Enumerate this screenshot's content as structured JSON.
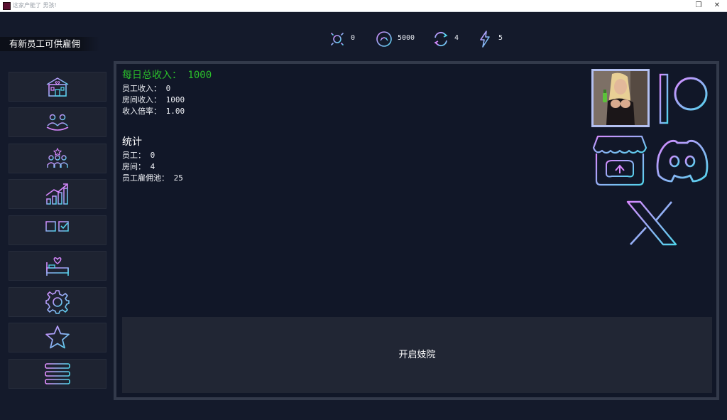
{
  "window": {
    "title": "这家产能了 男孩!",
    "restore_glyph": "❒",
    "close_glyph": "✕"
  },
  "notice": "有新员工可供雇佣",
  "stats": [
    {
      "icon": "sun-icon",
      "value": "0"
    },
    {
      "icon": "coin-icon",
      "value": "5000"
    },
    {
      "icon": "refresh-icon",
      "value": "4"
    },
    {
      "icon": "lightning-icon",
      "value": "5"
    }
  ],
  "sidebar": {
    "items": [
      {
        "icon": "brothel-building-icon"
      },
      {
        "icon": "staff-group-icon"
      },
      {
        "icon": "hire-staff-icon"
      },
      {
        "icon": "growth-chart-icon"
      },
      {
        "icon": "tasks-checklist-icon"
      },
      {
        "icon": "room-bed-icon"
      },
      {
        "icon": "settings-gear-icon"
      },
      {
        "icon": "star-icon"
      },
      {
        "icon": "menu-icon"
      }
    ]
  },
  "income": {
    "title": "每日总收入： 1000",
    "staff": "员工收入： 0",
    "rooms": "房间收入： 1000",
    "multiplier": "收入倍率： 1.00"
  },
  "statistics": {
    "title": "统计",
    "staff": "员工： 0",
    "rooms": "房间： 4",
    "pool": "员工雇佣池： 25"
  },
  "social": [
    "patreon-icon",
    "itch-io-icon",
    "discord-icon",
    "x-icon"
  ],
  "colors": {
    "accent_pink": "#d889ff",
    "accent_cyan": "#52d4ec",
    "income_green": "#2bbf2b"
  },
  "main_button": "开启妓院"
}
